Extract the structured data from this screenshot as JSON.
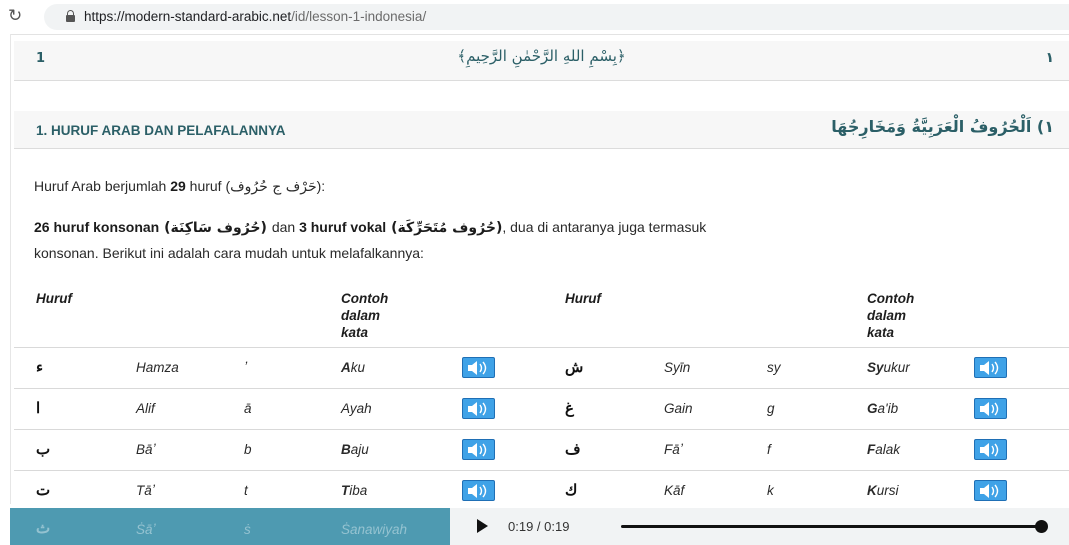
{
  "browser": {
    "url_host": "https://modern-standard-arabic.net",
    "url_path": "/id/lesson-1-indonesia/"
  },
  "header": {
    "number_left": "1",
    "bismillah": "﴿بِسْمِ اللهِ الرَّحْمٰنِ الرَّحِيمِ﴾",
    "number_right": "١"
  },
  "section": {
    "title": "1. HURUF ARAB DAN PELAFALANNYA",
    "title_ar": "١) اَلْحُرُوفُ الْعَرَبِيَّةُ وَمَخَارِجُهَا"
  },
  "intro": {
    "p1_pre": "Huruf Arab berjumlah ",
    "p1_bold": "29",
    "p1_mid": " huruf  (",
    "p1_ar": "حَرْف ج حُرُوف",
    "p1_post": "):",
    "p2_b1": "26 huruf konsonan",
    "p2_ar1": " (حُرُوف سَاكِنَة) ",
    "p2_mid": " dan ",
    "p2_b2": "3 huruf vokal",
    "p2_ar2": " (حُرُوف مُتَحَرِّكَة)",
    "p2_post": ", dua di antaranya juga termasuk",
    "p3": "konsonan. Berikut ini adalah cara mudah untuk melafalkannya:"
  },
  "table": {
    "headers": {
      "huruf_left": "Huruf",
      "contoh_left_1": "Contoh",
      "contoh_left_2": "dalam",
      "contoh_left_3": "kata",
      "huruf_right": "Huruf",
      "contoh_right_1": "Contoh",
      "contoh_right_2": "dalam",
      "contoh_right_3": "kata"
    },
    "rows": [
      {
        "l_ar": "ء",
        "l_name": "Hamza",
        "l_trans": "ʼ",
        "l_ex_hl": "A",
        "l_ex_rest": "ku",
        "r_ar": "ش",
        "r_name": "Syīn",
        "r_trans": "sy",
        "r_ex_hl": "Sy",
        "r_ex_rest": "ukur"
      },
      {
        "l_ar": "ا",
        "l_name": "Alif",
        "l_trans": "ā",
        "l_ex_hl": "",
        "l_ex_rest": "Ayah",
        "r_ar": "غ",
        "r_name": "Gain",
        "r_trans": "g",
        "r_ex_hl": "G",
        "r_ex_rest": "a'ib"
      },
      {
        "l_ar": "ب",
        "l_name": "Bāʼ",
        "l_trans": "b",
        "l_ex_hl": "B",
        "l_ex_rest": "aju",
        "r_ar": "ف",
        "r_name": "Fāʼ",
        "r_trans": "f",
        "r_ex_hl": "F",
        "r_ex_rest": "alak"
      },
      {
        "l_ar": "ت",
        "l_name": "Tāʼ",
        "l_trans": "t",
        "l_ex_hl": "T",
        "l_ex_rest": "iba",
        "r_ar": "ك",
        "r_name": "Kāf",
        "r_trans": "k",
        "r_ex_hl": "K",
        "r_ex_rest": "ursi"
      }
    ],
    "partial_row": {
      "l_ar": "ث",
      "l_name": "Ṡāʼ",
      "l_trans": "ṡ",
      "l_ex": "Ṡanawiyah"
    }
  },
  "audio": {
    "time": "0:19 / 0:19",
    "progress": 1.0
  },
  "colors": {
    "accent": "#2b5f67",
    "speaker": "#3fa2e7",
    "overlay": "#4e9ab1"
  }
}
